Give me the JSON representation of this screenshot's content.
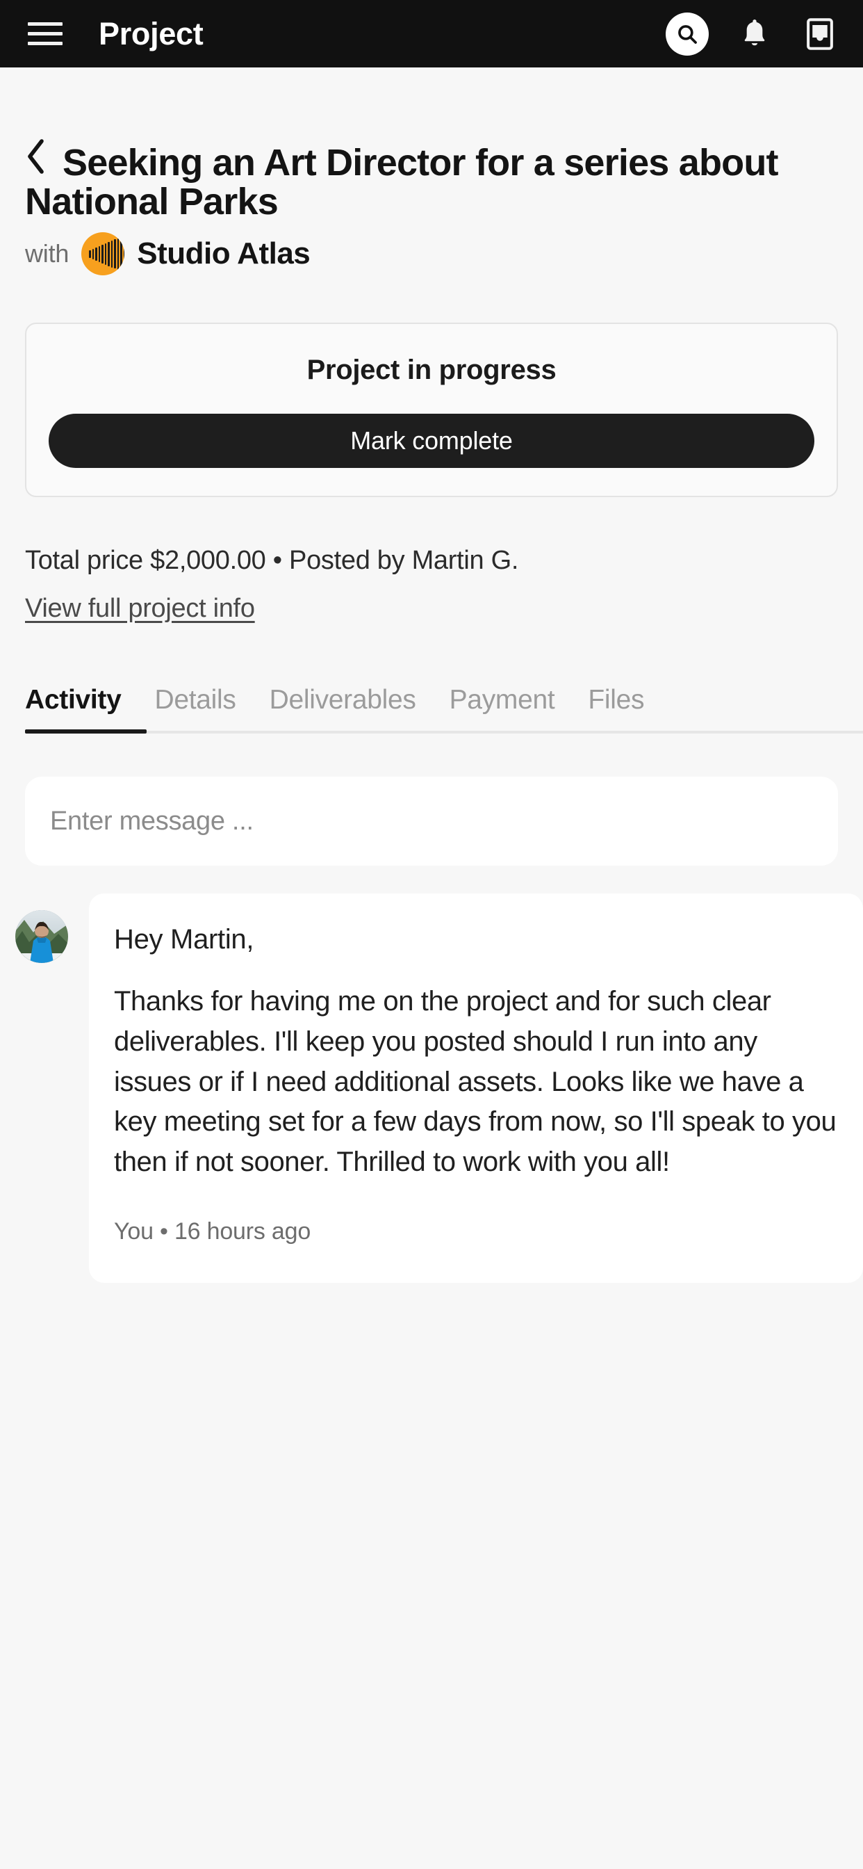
{
  "topbar": {
    "menu_icon": "hamburger-menu-icon",
    "title": "Project",
    "search_icon": "search-icon",
    "notifications_icon": "bell-icon",
    "inbox_icon": "inbox-tray-icon",
    "background_color": "#111111"
  },
  "header": {
    "back_icon": "chevron-left-icon",
    "project_title": "Seeking an Art Director for a series about National Parks",
    "with_label": "with",
    "studio_name": "Studio Atlas",
    "studio_logo_color": "#f7a01e"
  },
  "status_card": {
    "status_text": "Project in progress",
    "action_label": "Mark complete",
    "action_color": "#1e1e1e"
  },
  "meta": {
    "summary": "Total price $2,000.00 • Posted by Martin G.",
    "total_price": "$2,000.00",
    "posted_by": "Martin G.",
    "link_label": "View full project info"
  },
  "tabs": [
    {
      "label": "Activity",
      "active": true
    },
    {
      "label": "Details",
      "active": false
    },
    {
      "label": "Deliverables",
      "active": false
    },
    {
      "label": "Payment",
      "active": false
    },
    {
      "label": "Files",
      "active": false
    }
  ],
  "composer": {
    "placeholder": "Enter message ...",
    "value": ""
  },
  "message": {
    "avatar_alt": "person-in-blue-jacket-outdoors",
    "greeting": "Hey Martin,",
    "body": "Thanks for having me on the project and for such clear deliverables. I'll keep you posted should I run into any issues or if I need additional assets. Looks like we have a key meeting set for a few days from now, so I'll speak to you then if not sooner. Thrilled to work with you all!",
    "author": "You",
    "timestamp": "16 hours ago",
    "footer": "You • 16 hours ago"
  }
}
